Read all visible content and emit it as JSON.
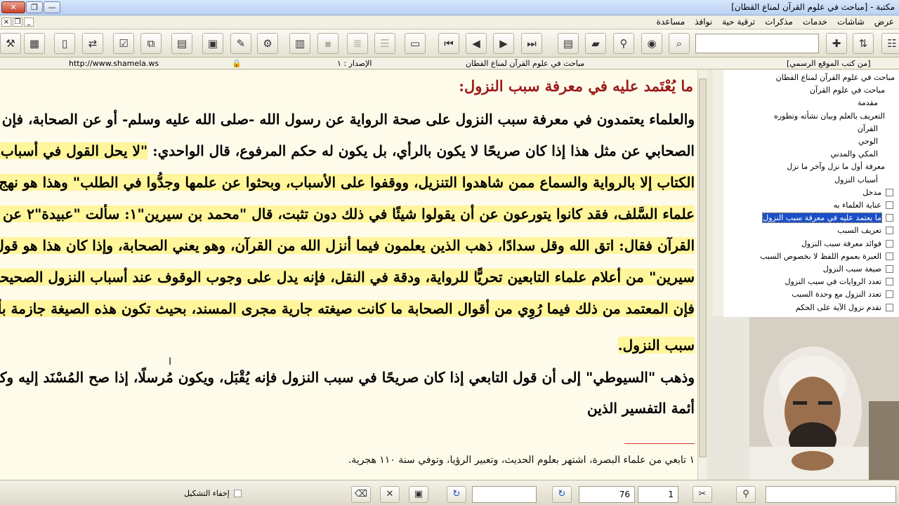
{
  "window": {
    "title": "مكتبة - [مباحث في علوم القرآن لمناع القطان]",
    "close": "✕",
    "maximize": "❐",
    "minimize": "—"
  },
  "menu": [
    "عرض",
    "شاشات",
    "خدمات",
    "مذكرات",
    "ترقية حية",
    "نوافذ",
    "مساعدة"
  ],
  "infobar": {
    "book_title": "مباحث في علوم القرآن لمناع القطان",
    "edition": "الإصدار : ١",
    "website": "http://www.shamela.ws",
    "source": "[من كتب الموقع الرسمي]"
  },
  "content": {
    "heading": "ما يُعْتَمد عليه في معرفة سبب النزول:",
    "lines": [
      {
        "pre": "والعلماء يعتمدون في معرفة سبب النزول على صحة الرواية عن رسول الله -صلى الله عليه وسلم- أو عن الصحابة، فإن إخبار",
        "hl": ""
      },
      {
        "pre": "الصحابي عن مثل هذا إذا كان صريحًا لا يكون بالرأي، بل يكون له حكم المرفوع، قال الواحدي: ",
        "hl": "\"لا يحل القول في أسباب نزول"
      },
      {
        "pre": "",
        "hl": "الكتاب إلا بالرواية والسماع ممن شاهدوا التنزيل، ووقفوا على الأسباب، وبحثوا عن علمها وجدُّوا في الطلب\" وهذا هو نهج"
      },
      {
        "pre": "",
        "hl": "علماء السَّلف، فقد كانوا يتورعون عن أن يقولوا شيئًا في ذلك دون تثبت، قال \"محمد بن سيرين\"١: سألت \"عبيدة\"٢ عن آية من"
      },
      {
        "pre": "",
        "hl": "القرآن فقال: اتق الله وقل سدادًا، ذهب الذين يعلمون فيما أنزل الله من القرآن، وهو يعني الصحابة، وإذا كان هذا هو قول \"ابن"
      },
      {
        "pre": "",
        "hl": "سيرين\" من أعلام علماء التابعين تحريًّا للرواية، ودقة في النقل، فإنه يدل على وجوب الوقوف عند أسباب النزول الصحيحة، ولذا"
      },
      {
        "pre": "",
        "hl": "فإن المعتمد من ذلك فيما رُوِي من أقوال الصحابة ما كانت صيغته جارية مجرى المسند، بحيث تكون هذه الصيغة جازمة بأنها"
      },
      {
        "pre": "",
        "hl": "سبب النزول."
      },
      {
        "pre": "وذهب \"السيوطي\" إلى أن قول التابعي إذا كان صريحًا في سبب النزول فإنه يُقْبَل، ويكون مُرسلًا، إذا صح المُسْنَد إليه وكان من",
        "hl": ""
      },
      {
        "pre": "أئمة التفسير الذين",
        "hl": ""
      }
    ],
    "footnote": "١ تابعي من علماء البصرة، اشتهر بعلوم الحديث، وتعبير الرؤيا، وتوفي سنة ١١٠ هجرية."
  },
  "tree": {
    "items": [
      {
        "label": "مباحث في علوم القرآن لمناع القطان",
        "selected": false
      },
      {
        "label": "مباحث في علوم القرآن",
        "selected": false
      },
      {
        "label": "مقدمة",
        "selected": false
      },
      {
        "label": "التعريف بالعلم وبيان نشأته وتطوره",
        "selected": false
      },
      {
        "label": "القرآن",
        "selected": false
      },
      {
        "label": "الوحي",
        "selected": false
      },
      {
        "label": "المكي والمدني",
        "selected": false
      },
      {
        "label": "معرفة أول ما نزل وآخر ما نزل",
        "selected": false
      },
      {
        "label": "أسباب النزول",
        "selected": false
      },
      {
        "label": "مدخل",
        "selected": false
      },
      {
        "label": "عناية العلماء به",
        "selected": false
      },
      {
        "label": "ما يعتمد عليه في معرفة سبب النزول",
        "selected": true
      },
      {
        "label": "تعريف السبب",
        "selected": false
      },
      {
        "label": "فوائد معرفة سبب النزول",
        "selected": false
      },
      {
        "label": "العبرة بعموم اللفظ لا بخصوص السبب",
        "selected": false
      },
      {
        "label": "صيغة سبب النزول",
        "selected": false
      },
      {
        "label": "تعدد الروايات في سبب النزول",
        "selected": false
      },
      {
        "label": "تعدد النزول مع وحدة السبب",
        "selected": false
      },
      {
        "label": "تقدم نزول الآية على الحكم",
        "selected": false
      }
    ]
  },
  "bottombar": {
    "hide_tashkeel": "إخفاء التشكيل",
    "page_value": "76",
    "part_value": "1"
  },
  "colors": {
    "highlight": "#fff59a",
    "heading": "#9b1a1a",
    "background": "#fefbea",
    "selection": "#1b4fc7"
  }
}
